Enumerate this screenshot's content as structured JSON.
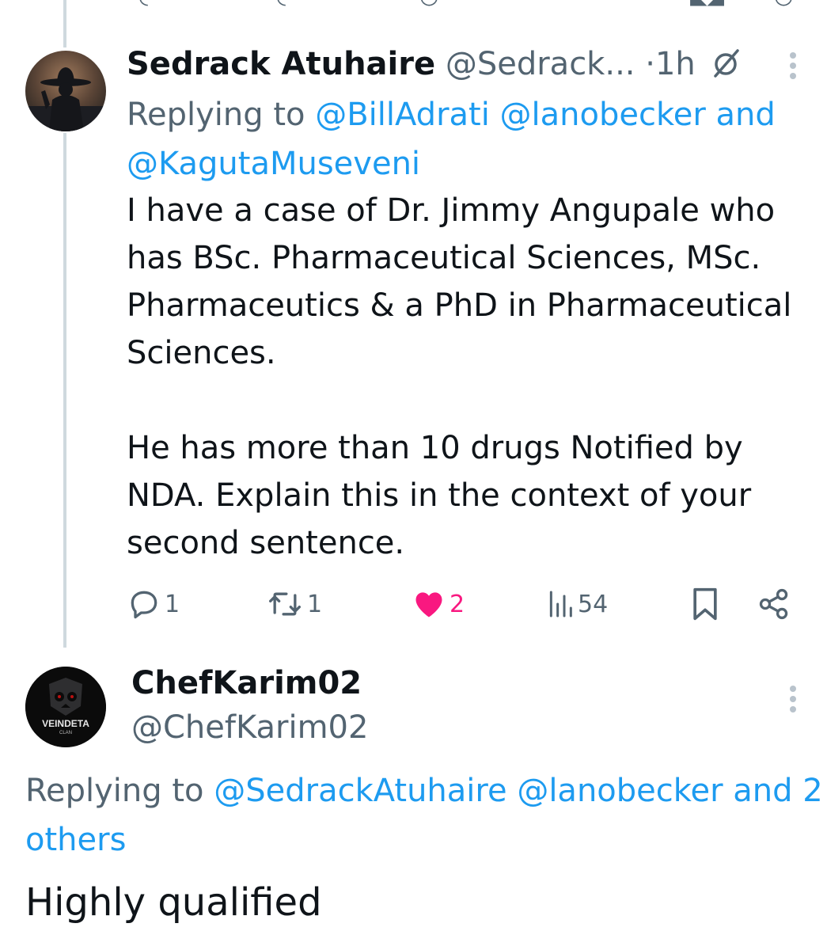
{
  "tweet1": {
    "display_name": "Sedrack Atuhaire",
    "handle": "@Sedrack...",
    "separator": "·",
    "time": "1h",
    "replying_prefix": "Replying to",
    "mentions": [
      "@BillAdrati",
      "@lanobecker"
    ],
    "and_word": "and",
    "last_mention": "@KagutaMuseveni",
    "body_paragraphs": [
      "I have a case of Dr. Jimmy Angupale who has BSc. Pharmaceutical Sciences, MSc. Pharmaceutics & a PhD in Pharmaceutical Sciences.",
      "He has more than 10 drugs Notified by NDA. Explain this in the context of your second sentence."
    ],
    "stats": {
      "replies": "1",
      "reposts": "1",
      "likes": "2",
      "views": "54"
    }
  },
  "tweet2": {
    "display_name": "ChefKarim02",
    "handle": "@ChefKarim02",
    "avatar_text": "VEINDETA",
    "avatar_subtext": "CLAN",
    "replying_prefix": "Replying to",
    "mentions": [
      "@SedrackAtuhaire",
      "@lanobecker"
    ],
    "and_others": "and 2 others",
    "body": "Highly qualified"
  },
  "colors": {
    "link": "#1d9bf0",
    "muted": "#536471",
    "like": "#f91880",
    "text": "#0f1419"
  }
}
